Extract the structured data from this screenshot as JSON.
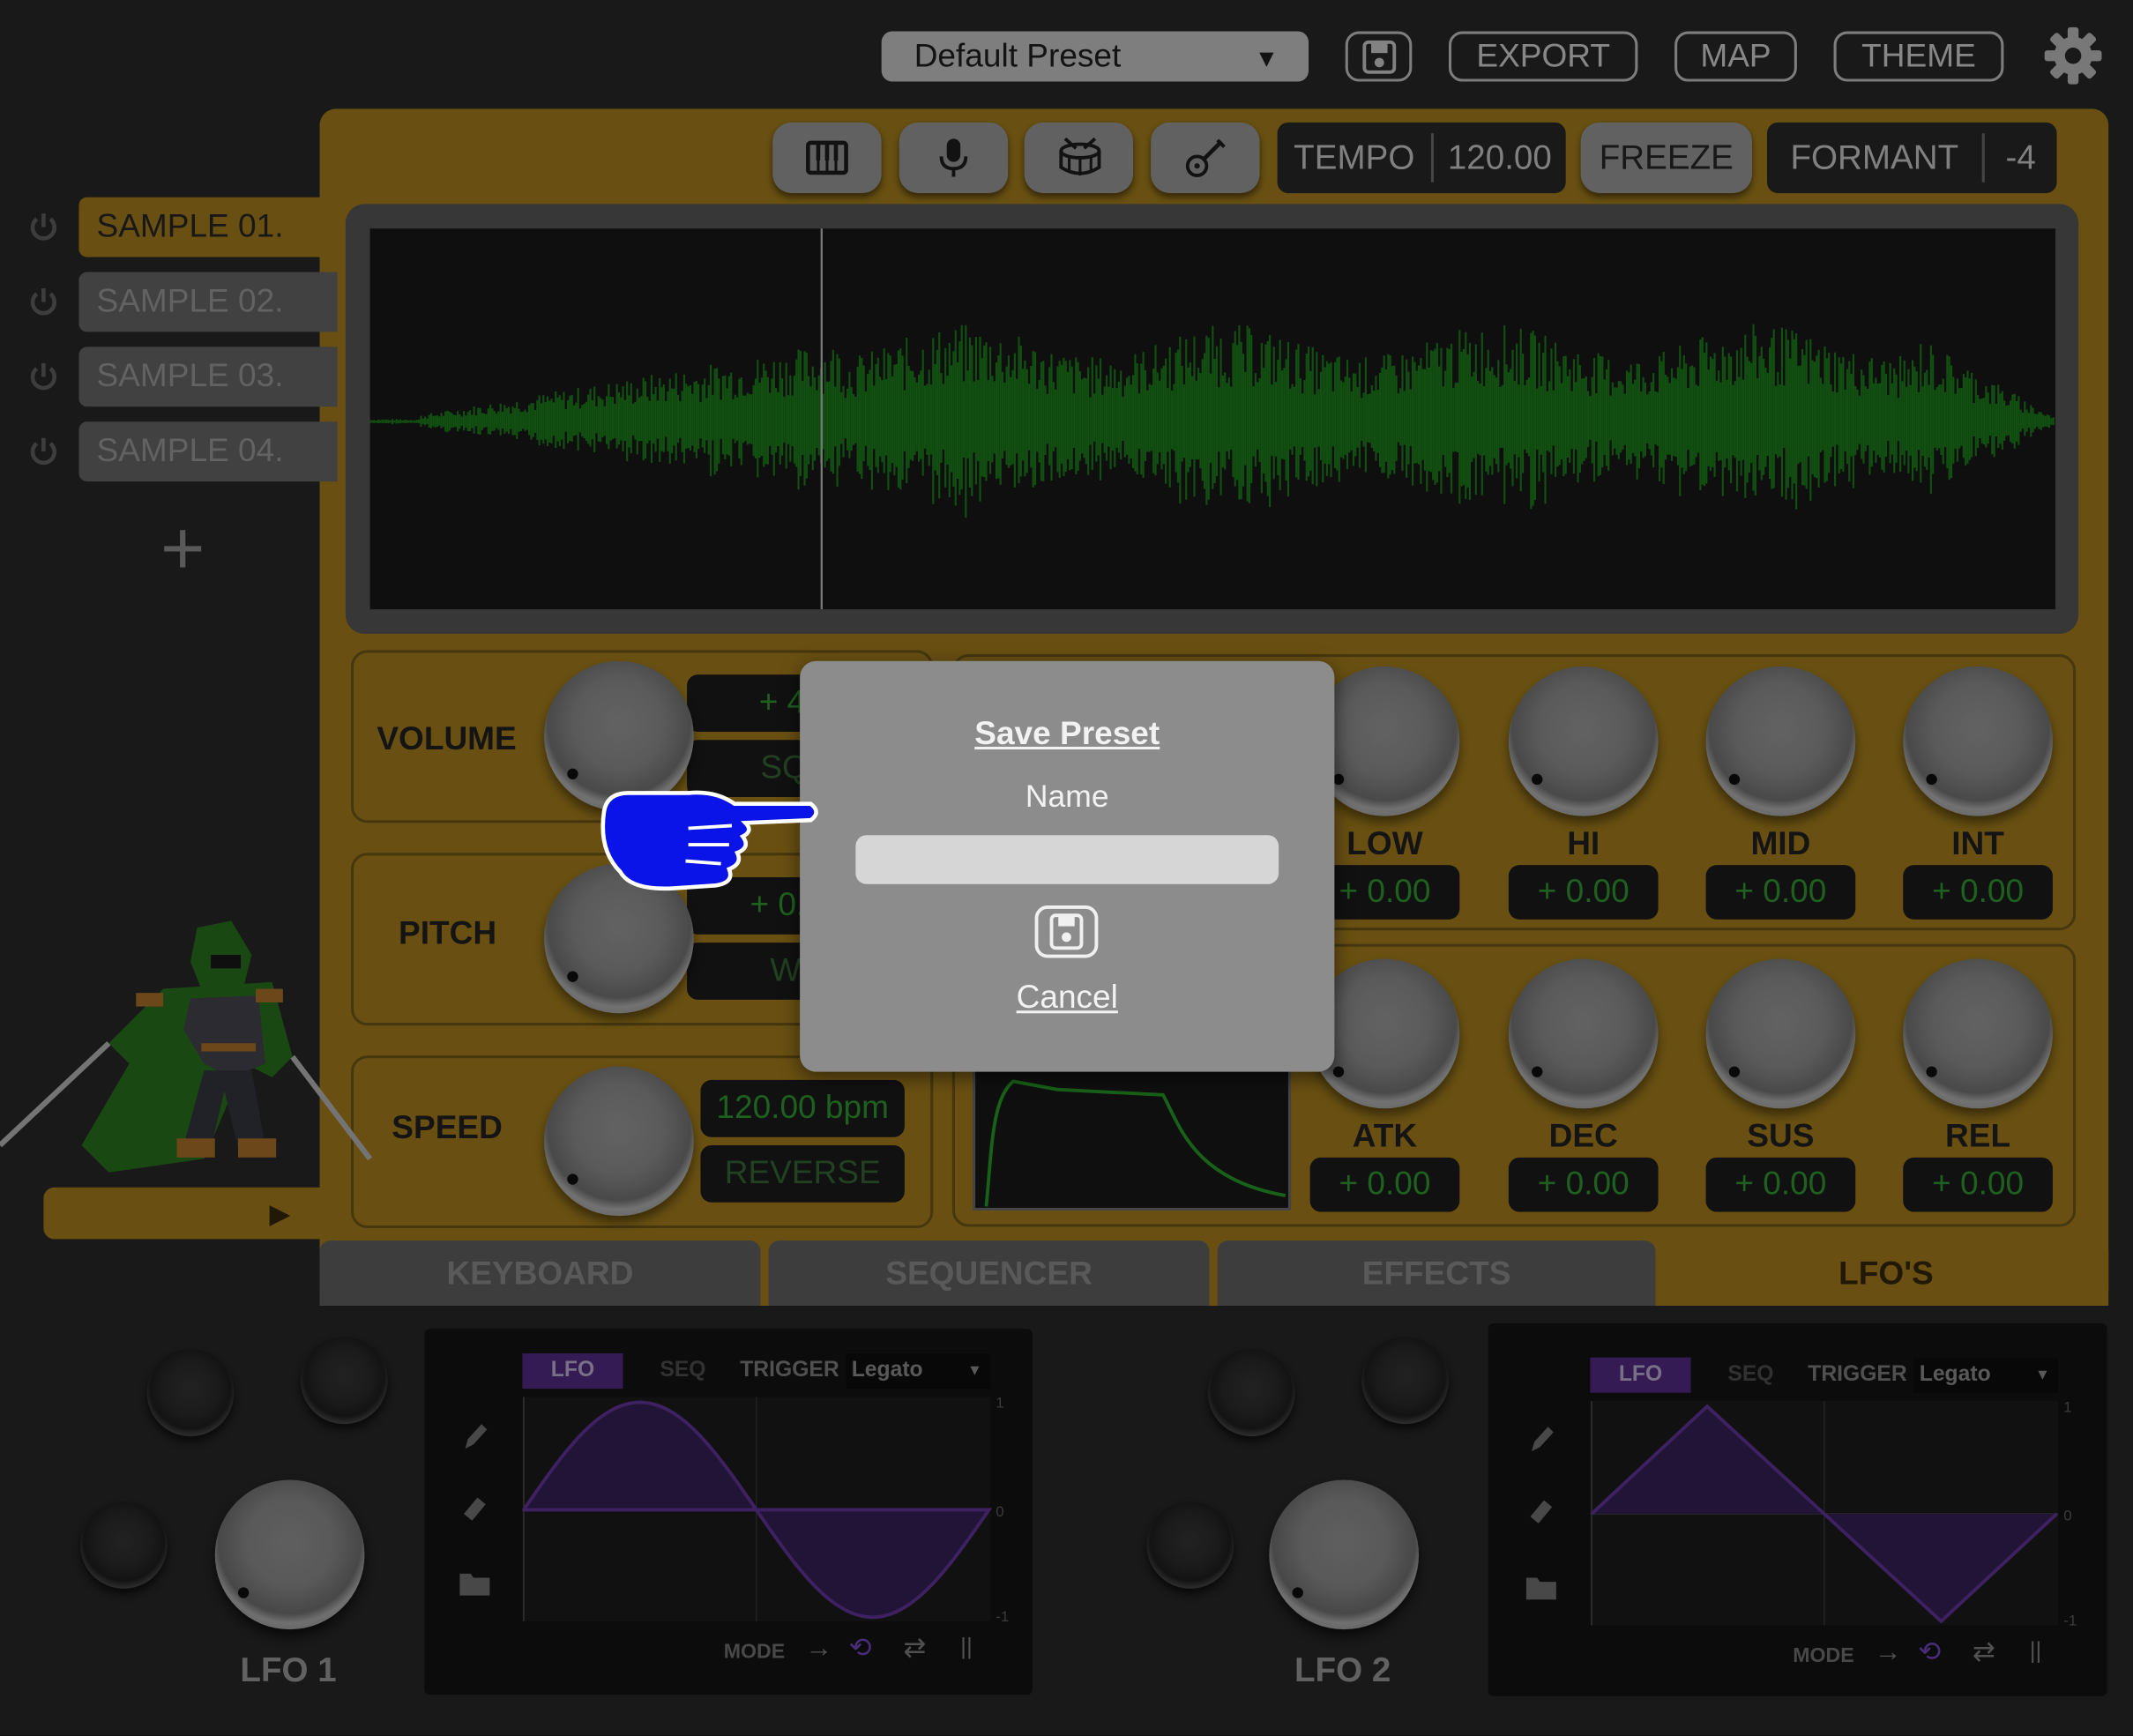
{
  "header": {
    "preset_name": "Default Preset",
    "export_label": "EXPORT",
    "map_label": "MAP",
    "theme_label": "THEME"
  },
  "toolbar": {
    "tempo_label": "TEMPO",
    "tempo_value": "120.00",
    "freeze_label": "FREEZE",
    "formant_label": "FORMANT",
    "formant_value": "-4"
  },
  "samples": [
    {
      "label": "SAMPLE 01."
    },
    {
      "label": "SAMPLE 02."
    },
    {
      "label": "SAMPLE 03."
    },
    {
      "label": "SAMPLE 04."
    }
  ],
  "add_sample_label": "+",
  "controls": {
    "volume": {
      "label": "VOLUME",
      "value": "+ 4.8",
      "mode": "SQU"
    },
    "pitch": {
      "label": "PITCH",
      "value": "+ 0.00",
      "mode": "WA"
    },
    "speed": {
      "label": "SPEED",
      "value": "120.00 bpm",
      "mode": "REVERSE"
    }
  },
  "eq": [
    {
      "label": "LOW",
      "value": "+ 0.00"
    },
    {
      "label": "HI",
      "value": "+ 0.00"
    },
    {
      "label": "MID",
      "value": "+ 0.00"
    },
    {
      "label": "INT",
      "value": "+ 0.00"
    }
  ],
  "envelope": [
    {
      "label": "ATK",
      "value": "+ 0.00"
    },
    {
      "label": "DEC",
      "value": "+ 0.00"
    },
    {
      "label": "SUS",
      "value": "+ 0.00"
    },
    {
      "label": "REL",
      "value": "+ 0.00"
    }
  ],
  "tabs": [
    {
      "label": "KEYBOARD"
    },
    {
      "label": "SEQUENCER"
    },
    {
      "label": "EFFECTS"
    },
    {
      "label": "LFO'S"
    }
  ],
  "lfo1": {
    "title": "LFO 1",
    "tab_lfo": "LFO",
    "tab_seq": "SEQ",
    "trigger_label": "TRIGGER",
    "trigger_value": "Legato",
    "mode_label": "MODE",
    "axis": [
      "1",
      "0",
      "-1"
    ]
  },
  "lfo2": {
    "title": "LFO 2",
    "tab_lfo": "LFO",
    "tab_seq": "SEQ",
    "trigger_label": "TRIGGER",
    "trigger_value": "Legato",
    "mode_label": "MODE",
    "axis": [
      "1",
      "0",
      "-1"
    ]
  },
  "dialog": {
    "title": "Save Preset",
    "name_label": "Name",
    "name_value": "",
    "cancel_label": "Cancel"
  },
  "colors": {
    "accent_gold": "#b58b1f",
    "waveform_green": "#1f8a1f",
    "value_green": "#35a635",
    "lfo_purple": "#5a2f8f",
    "pointer_blue": "#0a14e8"
  }
}
